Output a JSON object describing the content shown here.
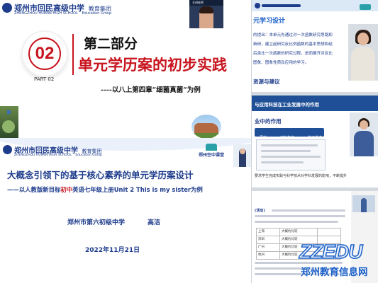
{
  "slide1": {
    "school_cn": "郑州市回民高级中学",
    "school_group": "教育集团",
    "school_en": "ZHENGZHOU HUIMIN HIGH SCHOOL",
    "school_en_group": "Education Group",
    "part_number": "02",
    "part_label": "PART 02",
    "part_title": "第二部分",
    "title": "单元学历案的初步实践",
    "subtitle": "----以八上第四章“细菌真菌”为例",
    "video_tile_label": "主讲老师"
  },
  "slide2": {
    "school_cn": "郑州市回民高级中学",
    "school_group": "教育集团",
    "school_en": "ZHENGZHOU HUIMIN HIGH SCHOOL",
    "school_en_group": "Education Group",
    "partner_logo": "郑州空中课堂",
    "title": "大概念引领下的基于核心素养的单元学历案设计",
    "subtitle_dash": "——以人教版新目标",
    "subtitle_highlight": "初中",
    "subtitle_rest": "英语七年级上册Unit 2 This is my sister为例",
    "school": "郑州市第六初级中学",
    "author": "高洁",
    "date": "2022年11月21日"
  },
  "top_right": {
    "header": "元学习设计",
    "lines": [
      "的提出：本单元先通过对一次函数研究思路和",
      "新研，建立起研究反比例函数的基本思想和经",
      "后类比一次函数的研究过程，进而展开对反比",
      "图象、图象性质及应用的学习。"
    ],
    "footer": "资源与建议"
  },
  "mid_right": {
    "header": "与应用科技在工业发展中的作用",
    "subheader": "业中的作用",
    "tabs": [
      "原料",
      "材料生产",
      "能力推进"
    ],
    "caption": "要求学生完成实践与科学技术对学科发展的影响，不断提升"
  },
  "bottom_right": {
    "section_title": "(活动)",
    "table_rows": [
      [
        "上海",
        "大概约比较",
        ""
      ],
      [
        "深圳",
        "大概约比较",
        ""
      ],
      [
        "广州",
        "大概约比较",
        ""
      ],
      [
        "杭州",
        "大概约比较",
        ""
      ]
    ]
  },
  "watermark": {
    "logo_text": "ZZEDU",
    "site_name": "郑州教育信息网"
  },
  "colors": {
    "red": "#c8141e",
    "navy": "#1e3c8c",
    "blue_accent": "#1a5fc8",
    "gold": "#e6b93c"
  }
}
